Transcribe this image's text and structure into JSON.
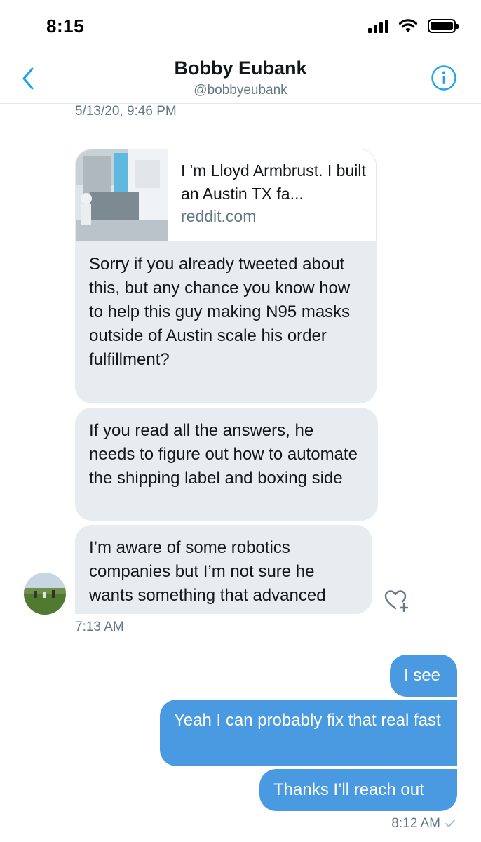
{
  "status_bar": {
    "time": "8:15"
  },
  "header": {
    "title": "Bobby Eubank",
    "handle": "@bobbyeubank"
  },
  "conversation": {
    "date_stamp": "5/13/20, 9:46 PM",
    "link_card": {
      "title": "I 'm Lloyd Armbrust. I built an Austin TX fa...",
      "domain": "reddit.com"
    },
    "incoming": [
      {
        "text": "Sorry if you already tweeted about this, but any chance you know how to help this guy making N95 masks outside of Austin scale his order fulfillment?"
      },
      {
        "text": "If you read all the answers, he needs to figure out how to automate the shipping label and boxing side"
      },
      {
        "text": "I’m aware of some robotics companies but I’m not sure he wants something that advanced"
      }
    ],
    "incoming_time": "7:13 AM",
    "outgoing": [
      {
        "text": "I see"
      },
      {
        "text": "Yeah I can probably fix that real fast"
      },
      {
        "text": "Thanks I’ll reach out"
      }
    ],
    "outgoing_time": "8:12 AM"
  },
  "colors": {
    "accent": "#1da1f2",
    "outgoing_bubble": "#4a9ae1",
    "incoming_bubble": "#e6ecf0",
    "secondary_text": "#657786"
  },
  "icons": [
    "back-chevron-icon",
    "info-icon",
    "heart-add-icon",
    "read-check-icon",
    "signal-icon",
    "wifi-icon",
    "battery-icon"
  ]
}
